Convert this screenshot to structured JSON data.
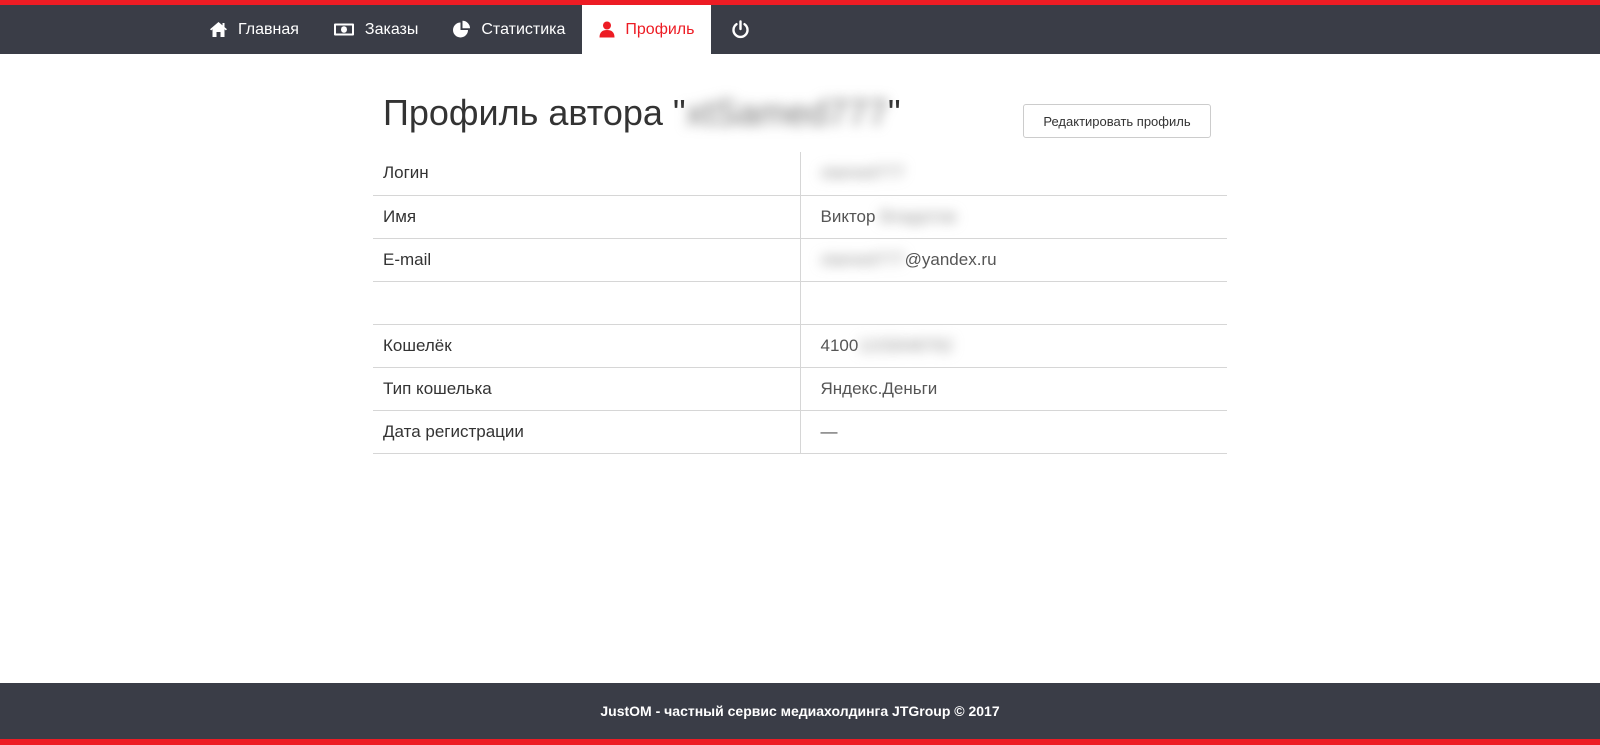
{
  "nav": {
    "items": [
      {
        "label": "Главная",
        "icon": "home-icon"
      },
      {
        "label": "Заказы",
        "icon": "money-icon"
      },
      {
        "label": "Статистика",
        "icon": "pie-chart-icon"
      },
      {
        "label": "Профиль",
        "icon": "user-icon",
        "active": true
      },
      {
        "label": "",
        "icon": "power-icon"
      }
    ]
  },
  "page": {
    "title_prefix": "Профиль автора \"",
    "title_author": "xtSamed777",
    "title_suffix": "\"",
    "edit_button": "Редактировать профиль"
  },
  "profile": {
    "rows": [
      {
        "label": "Логин",
        "value": "",
        "blurred": "xtamed777"
      },
      {
        "label": "Имя",
        "value": "Виктор ",
        "blurred": "Владотов"
      },
      {
        "label": "E-mail",
        "blurred_prefix": "xtamed777",
        "value": "@yandex.ru"
      },
      {
        "label": "",
        "value": ""
      },
      {
        "label": "Кошелёк",
        "value": "4100",
        "blurred": "1233048762"
      },
      {
        "label": "Тип кошелька",
        "value": "Яндекс.Деньги"
      },
      {
        "label": "Дата регистрации",
        "value": "—"
      }
    ]
  },
  "footer": {
    "text": "JustOM - частный сервис медиахолдинга JTGroup © 2017"
  },
  "colors": {
    "accent": "#ed1c24",
    "nav_bg": "#3a3d47"
  }
}
